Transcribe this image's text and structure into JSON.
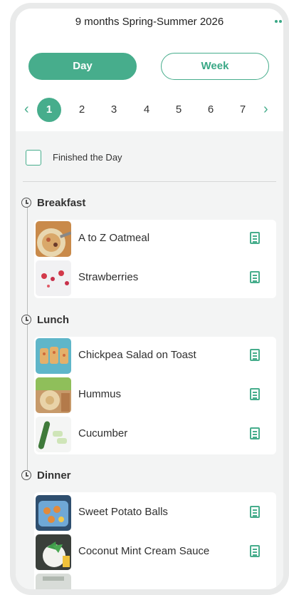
{
  "header": {
    "plan_title": "9 months Spring-Summer 2026",
    "more_icon": "more-dots-icon"
  },
  "view_toggle": {
    "day_label": "Day",
    "week_label": "Week",
    "selected": "Day"
  },
  "day_selector": {
    "prev_icon": "chevron-left-icon",
    "next_icon": "chevron-right-icon",
    "days": [
      "1",
      "2",
      "3",
      "4",
      "5",
      "6",
      "7"
    ],
    "selected": "1"
  },
  "finished": {
    "label": "Finished the Day",
    "checked": false
  },
  "meals": [
    {
      "name": "Breakfast",
      "items": [
        {
          "name": "A to Z Oatmeal",
          "image": "oatmeal-photo"
        },
        {
          "name": "Strawberries",
          "image": "strawberries-photo"
        }
      ]
    },
    {
      "name": "Lunch",
      "items": [
        {
          "name": "Chickpea Salad on Toast",
          "image": "chickpea-toast-photo"
        },
        {
          "name": "Hummus",
          "image": "hummus-photo"
        },
        {
          "name": "Cucumber",
          "image": "cucumber-photo"
        }
      ]
    },
    {
      "name": "Dinner",
      "items": [
        {
          "name": "Sweet Potato Balls",
          "image": "sweet-potato-balls-photo"
        },
        {
          "name": "Coconut Mint Cream Sauce",
          "image": "coconut-mint-sauce-photo"
        }
      ]
    }
  ],
  "colors": {
    "accent": "#47ad8c",
    "background": "#f3f4f4"
  }
}
